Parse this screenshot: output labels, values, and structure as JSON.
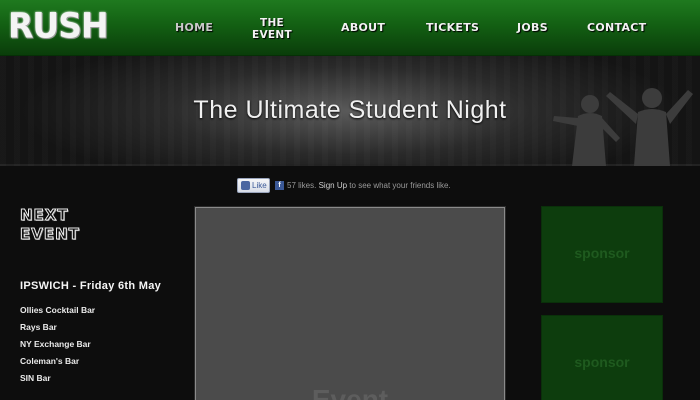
{
  "header": {
    "logo": "RUSH",
    "nav": {
      "home": "HOME",
      "event_line1": "THE",
      "event_line2": "EVENT",
      "about": "ABOUT",
      "tickets": "TICKETS",
      "jobs": "JOBS",
      "contact": "CONTACT"
    }
  },
  "banner": {
    "tagline": "The Ultimate Student Night"
  },
  "facebook": {
    "like_label": "Like",
    "likes_count": "57 likes.",
    "signup_label": "Sign Up",
    "signup_suffix": "to see what your friends like."
  },
  "next_event": {
    "heading_line1": "NEXT",
    "heading_line2": "EVENT",
    "city_date": "IPSWICH - Friday 6th May",
    "venues": [
      "Ollies Cocktail Bar",
      "Rays Bar",
      "NY Exchange Bar",
      "Coleman's Bar",
      "SIN Bar"
    ]
  },
  "event_panel": {
    "label": "Event"
  },
  "sponsors": [
    "sponsor",
    "sponsor"
  ],
  "colors": {
    "header_green": "#136013",
    "sponsor_green": "#0d3d0d",
    "background": "#0d0d0d"
  }
}
